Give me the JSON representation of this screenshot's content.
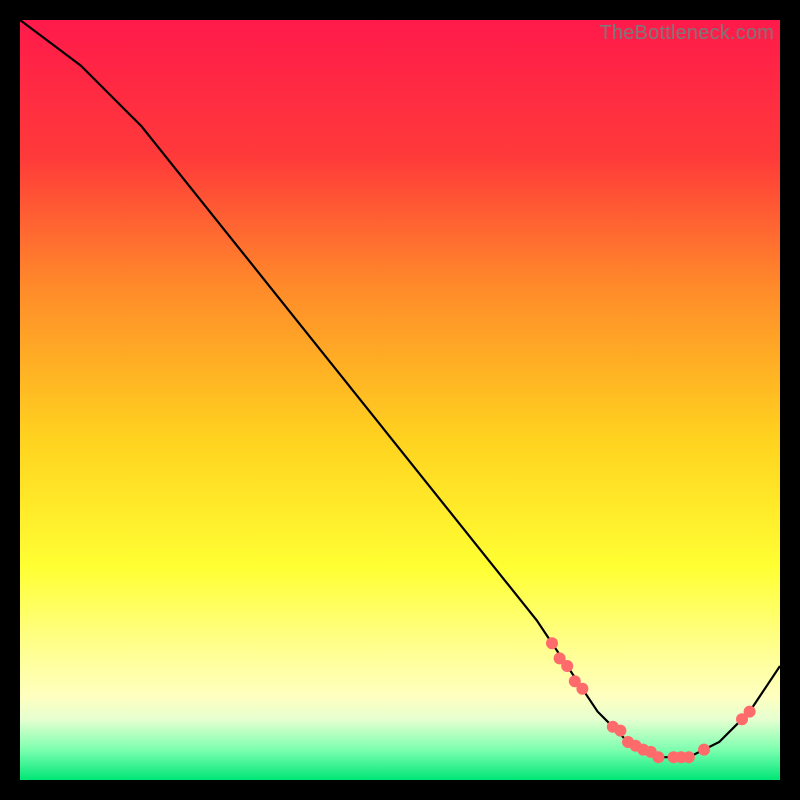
{
  "watermark": "TheBottleneck.com",
  "chart_data": {
    "type": "line",
    "title": "",
    "xlabel": "",
    "ylabel": "",
    "xlim": [
      0,
      100
    ],
    "ylim": [
      0,
      100
    ],
    "background_gradient": {
      "stops": [
        {
          "offset": 0.0,
          "color": "#ff1a4b"
        },
        {
          "offset": 0.18,
          "color": "#ff3a3a"
        },
        {
          "offset": 0.35,
          "color": "#ff8a2a"
        },
        {
          "offset": 0.55,
          "color": "#ffd21f"
        },
        {
          "offset": 0.72,
          "color": "#ffff33"
        },
        {
          "offset": 0.82,
          "color": "#ffff8a"
        },
        {
          "offset": 0.89,
          "color": "#ffffc0"
        },
        {
          "offset": 0.92,
          "color": "#e6ffd0"
        },
        {
          "offset": 0.96,
          "color": "#7dffb0"
        },
        {
          "offset": 1.0,
          "color": "#00e676"
        }
      ]
    },
    "series": [
      {
        "name": "bottleneck-curve",
        "color": "#000000",
        "x": [
          0,
          4,
          8,
          12,
          16,
          20,
          24,
          28,
          32,
          36,
          40,
          44,
          48,
          52,
          56,
          60,
          64,
          68,
          70,
          72,
          74,
          76,
          78,
          80,
          82,
          84,
          86,
          88,
          90,
          92,
          94,
          96,
          98,
          100
        ],
        "y": [
          100,
          97,
          94,
          90,
          86,
          81,
          76,
          71,
          66,
          61,
          56,
          51,
          46,
          41,
          36,
          31,
          26,
          21,
          18,
          15,
          12,
          9,
          7,
          5,
          4,
          3,
          3,
          3,
          4,
          5,
          7,
          9,
          12,
          15
        ]
      }
    ],
    "markers": {
      "color": "#ff6b6b",
      "radius": 6,
      "points": [
        {
          "x": 70,
          "y": 18
        },
        {
          "x": 71,
          "y": 16
        },
        {
          "x": 72,
          "y": 15
        },
        {
          "x": 73,
          "y": 13
        },
        {
          "x": 74,
          "y": 12
        },
        {
          "x": 78,
          "y": 7
        },
        {
          "x": 79,
          "y": 6.5
        },
        {
          "x": 80,
          "y": 5
        },
        {
          "x": 81,
          "y": 4.5
        },
        {
          "x": 82,
          "y": 4
        },
        {
          "x": 83,
          "y": 3.7
        },
        {
          "x": 84,
          "y": 3
        },
        {
          "x": 86,
          "y": 3
        },
        {
          "x": 87,
          "y": 3
        },
        {
          "x": 88,
          "y": 3
        },
        {
          "x": 90,
          "y": 4
        },
        {
          "x": 95,
          "y": 8
        },
        {
          "x": 96,
          "y": 9
        }
      ]
    }
  }
}
